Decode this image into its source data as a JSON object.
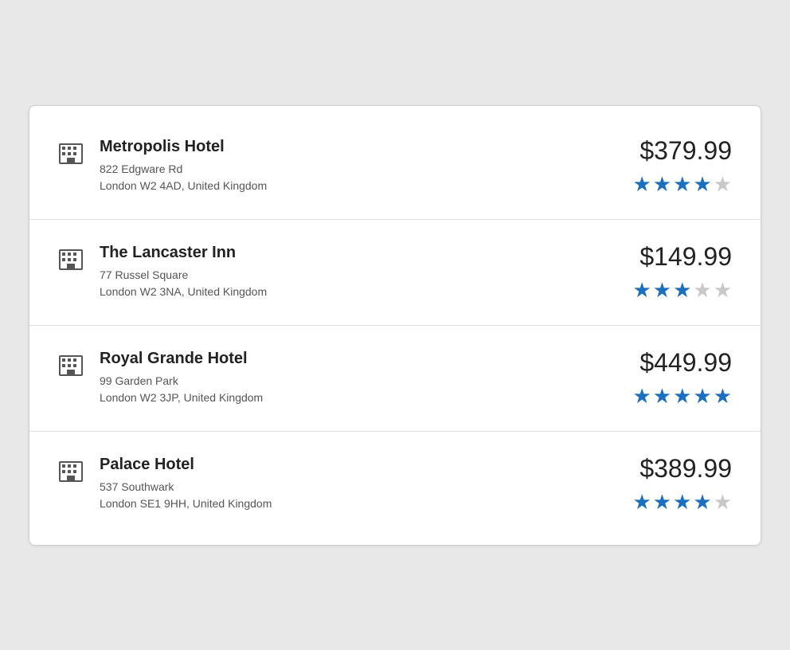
{
  "hotels": [
    {
      "id": "metropolis",
      "name": "Metropolis Hotel",
      "address_line1": "822 Edgware Rd",
      "address_line2": "London W2 4AD, United Kingdom",
      "price": "$379.99",
      "stars_filled": 4,
      "stars_empty": 1
    },
    {
      "id": "lancaster",
      "name": "The Lancaster Inn",
      "address_line1": "77 Russel Square",
      "address_line2": "London W2 3NA, United Kingdom",
      "price": "$149.99",
      "stars_filled": 3,
      "stars_empty": 2
    },
    {
      "id": "royalgrande",
      "name": "Royal Grande Hotel",
      "address_line1": "99 Garden Park",
      "address_line2": "London W2 3JP, United Kingdom",
      "price": "$449.99",
      "stars_filled": 5,
      "stars_empty": 0
    },
    {
      "id": "palace",
      "name": "Palace Hotel",
      "address_line1": "537 Southwark",
      "address_line2": "London SE1 9HH, United Kingdom",
      "price": "$389.99",
      "stars_filled": 4,
      "stars_empty": 1
    }
  ]
}
